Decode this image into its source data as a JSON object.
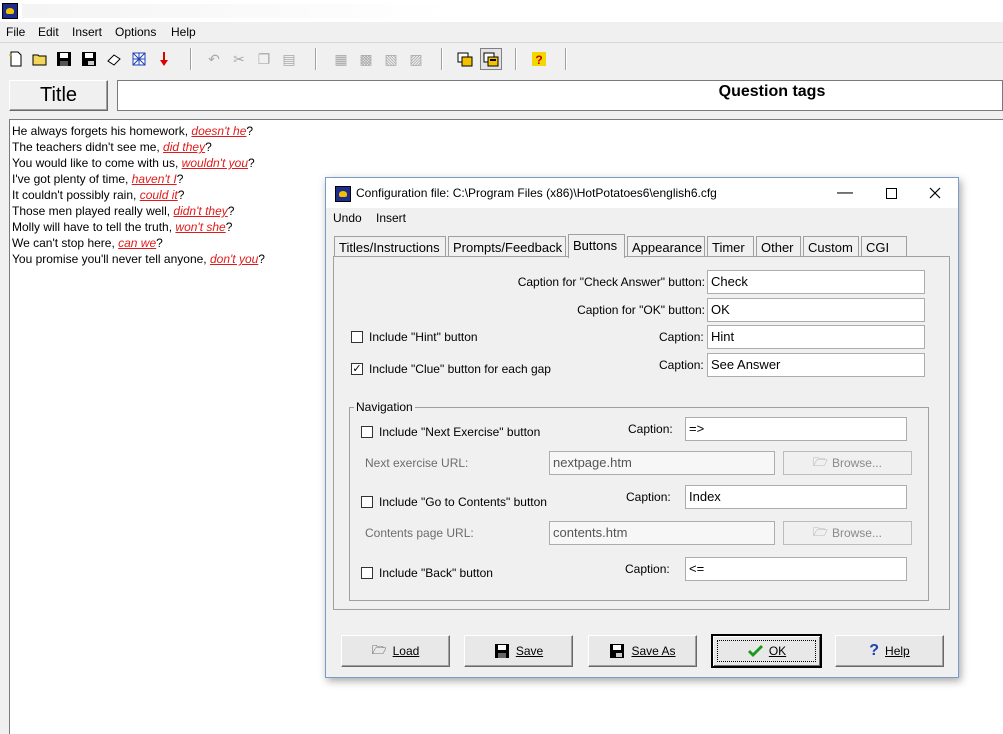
{
  "menubar": {
    "items": [
      "File",
      "Edit",
      "Insert",
      "Options",
      "Help"
    ]
  },
  "title_button": "Title",
  "title_value": "Question tags",
  "exercise": {
    "lines": [
      {
        "text": "He always forgets his homework, ",
        "gap": "doesn't he",
        "end": "?"
      },
      {
        "text": "The teachers didn't see me, ",
        "gap": "did they",
        "end": "?"
      },
      {
        "text": "You would like to come with us, ",
        "gap": "wouldn't you",
        "end": "?"
      },
      {
        "text": "I've got plenty of time, ",
        "gap": "haven't I",
        "end": "?"
      },
      {
        "text": "It couldn't possibly rain, ",
        "gap": "could it",
        "end": "?"
      },
      {
        "text": "Those men played really well, ",
        "gap": "didn't they",
        "end": "?"
      },
      {
        "text": "Molly will have to tell the truth, ",
        "gap": "won't she",
        "end": "?"
      },
      {
        "text": "We can't stop here, ",
        "gap": "can we",
        "end": "?"
      },
      {
        "text": "You promise you'll never tell anyone, ",
        "gap": "don't you",
        "end": "?"
      }
    ]
  },
  "dialog": {
    "title": "Configuration file: C:\\Program Files (x86)\\HotPotatoes6\\english6.cfg",
    "menu": [
      "Undo",
      "Insert"
    ],
    "tabs": [
      "Titles/Instructions",
      "Prompts/Feedback",
      "Buttons",
      "Appearance",
      "Timer",
      "Other",
      "Custom",
      "CGI"
    ],
    "active_tab": "Buttons",
    "check_label": "Caption for \"Check Answer\" button:",
    "check_value": "Check",
    "ok_label": "Caption for \"OK\" button:",
    "ok_value": "OK",
    "hint_label": "Include \"Hint\" button",
    "hint_checked": false,
    "hint_caption_label": "Caption:",
    "hint_value": "Hint",
    "clue_label": "Include \"Clue\" button for each gap",
    "clue_checked": true,
    "clue_caption_label": "Caption:",
    "clue_value": "See Answer",
    "navigation": {
      "title": "Navigation",
      "next_label": "Include \"Next Exercise\" button",
      "next_checked": false,
      "next_caption_label": "Caption:",
      "next_value": "=>",
      "next_url_label": "Next exercise URL:",
      "next_url_value": "nextpage.htm",
      "browse_label": "Browse...",
      "contents_label": "Include \"Go to Contents\" button",
      "contents_checked": false,
      "contents_caption_label": "Caption:",
      "contents_value": "Index",
      "contents_url_label": "Contents page URL:",
      "contents_url_value": "contents.htm",
      "back_label": "Include \"Back\" button",
      "back_checked": false,
      "back_caption_label": "Caption:",
      "back_value": "<="
    },
    "buttons": {
      "load": "Load",
      "save": "Save",
      "save_as": "Save As",
      "ok": "OK",
      "help": "Help"
    }
  },
  "colors": {
    "gap_text": "#e01b1b",
    "ok_check": "#1a9a1a",
    "help_icon": "#1f3fb0"
  }
}
